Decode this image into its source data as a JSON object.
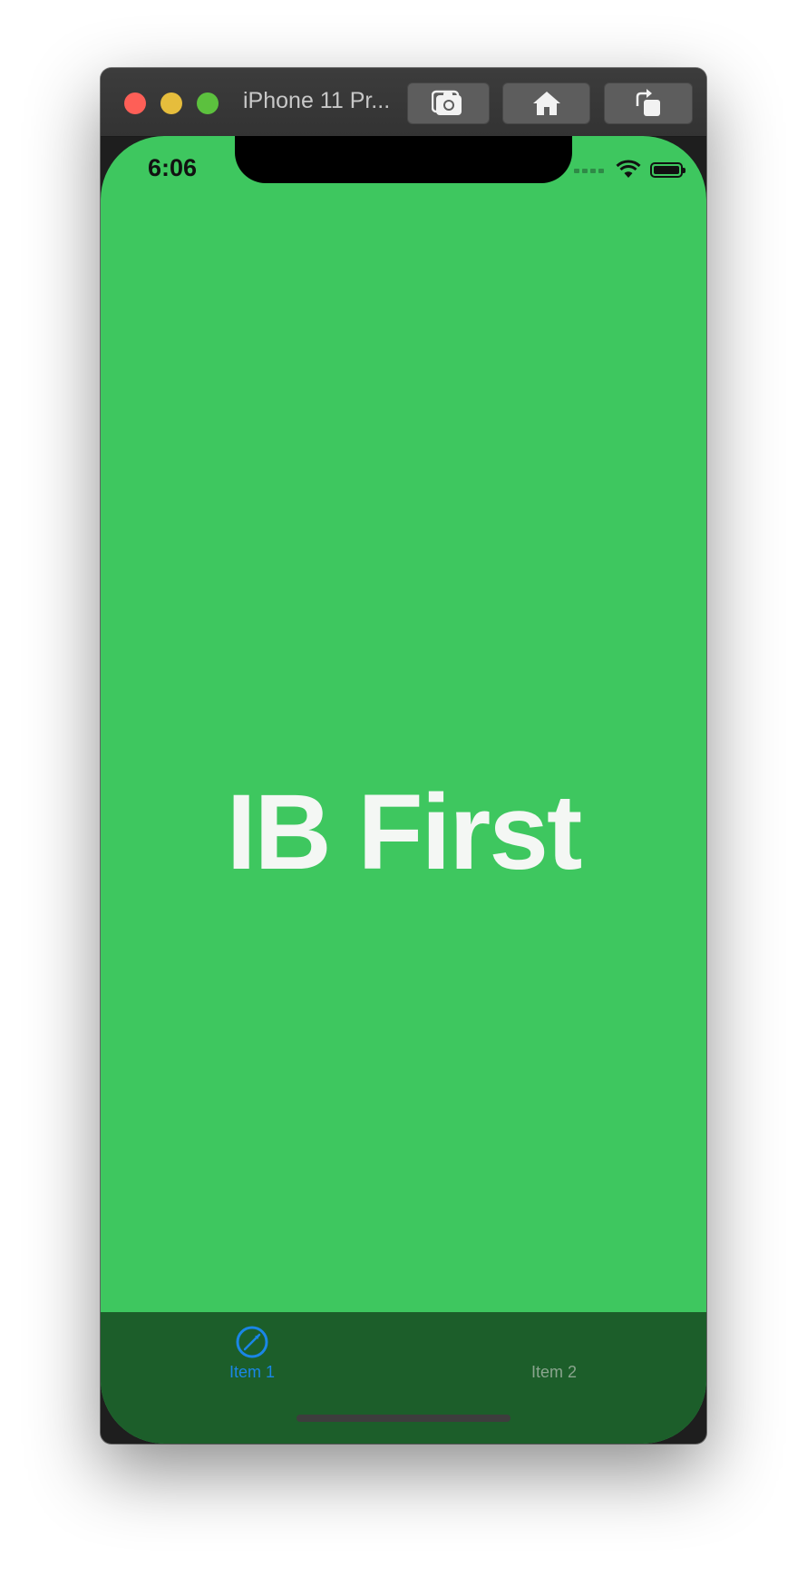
{
  "window": {
    "title": "iPhone 11 Pr...",
    "buttons": {
      "screenshot": "camera-icon",
      "home": "home-icon",
      "rotate": "rotate-icon"
    }
  },
  "status_bar": {
    "time": "6:06"
  },
  "main": {
    "headline": "IB First",
    "background_color": "#3ec75f"
  },
  "tab_bar": {
    "items": [
      {
        "label": "Item 1",
        "icon": "compass-icon",
        "selected": true
      },
      {
        "label": "Item 2",
        "icon": "",
        "selected": false
      }
    ],
    "selected_color": "#1a86e6",
    "unselected_color": "#8aa58e"
  }
}
